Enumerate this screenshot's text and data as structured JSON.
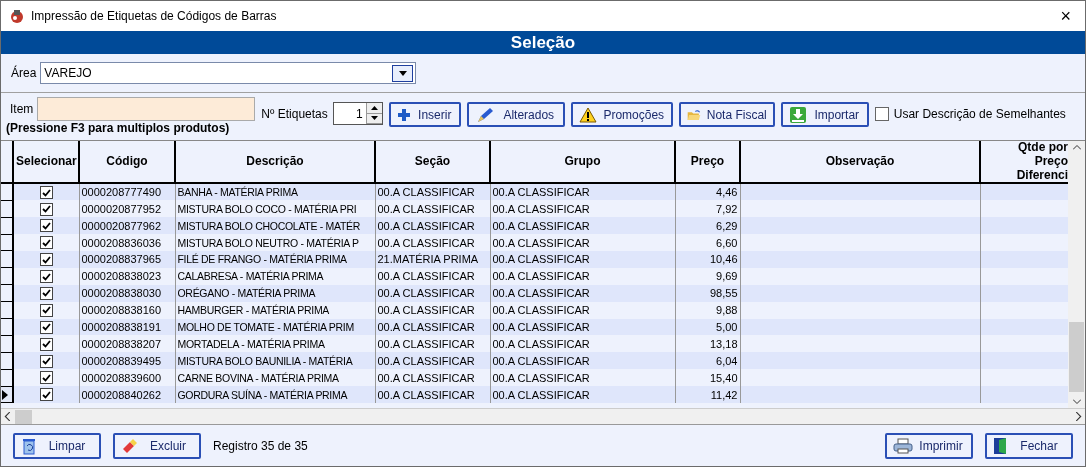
{
  "window": {
    "title": "Impressão de Etiquetas de Códigos de Barras",
    "close": "×"
  },
  "banner": "Seleção",
  "area": {
    "label": "Área",
    "value": "VAREJO"
  },
  "item": {
    "label": "Item",
    "hint": "(Pressione F3 para multiplos produtos)"
  },
  "labels_count": {
    "label": "Nº Etiquetas",
    "value": "1"
  },
  "toolbar": [
    {
      "label": "Inserir",
      "kind": "plus"
    },
    {
      "label": "Alterados",
      "kind": "pen"
    },
    {
      "label": "Promoções",
      "kind": "warning"
    },
    {
      "label": "Nota Fiscal",
      "kind": "folder"
    },
    {
      "label": "Importar",
      "kind": "download"
    }
  ],
  "similar_option": {
    "label": "Usar Descrição de Semelhantes",
    "checked": false
  },
  "table": {
    "columns": [
      "Selecionar",
      "Código",
      "Descrição",
      "Seção",
      "Grupo",
      "Preço",
      "Observação",
      "Qtde por Preço Diferenci"
    ],
    "rows": [
      {
        "selected": false,
        "checked": true,
        "code": "0000208777490",
        "description": "BANHA - MATÉRIA PRIMA",
        "section": "00.A CLASSIFICAR",
        "group": "00.A CLASSIFICAR",
        "price": "4,46"
      },
      {
        "selected": false,
        "checked": true,
        "code": "0000020877952",
        "description": "MISTURA BOLO COCO - MATÉRIA PRI",
        "section": "00.A CLASSIFICAR",
        "group": "00.A CLASSIFICAR",
        "price": "7,92"
      },
      {
        "selected": false,
        "checked": true,
        "code": "0000020877962",
        "description": "MISTURA BOLO CHOCOLATE - MATÉR",
        "section": "00.A CLASSIFICAR",
        "group": "00.A CLASSIFICAR",
        "price": "6,29"
      },
      {
        "selected": false,
        "checked": true,
        "code": "0000208836036",
        "description": "MISTURA BOLO NEUTRO - MATÉRIA P",
        "section": "00.A CLASSIFICAR",
        "group": "00.A CLASSIFICAR",
        "price": "6,60"
      },
      {
        "selected": false,
        "checked": true,
        "code": "0000208837965",
        "description": "FILÉ DE FRANGO - MATÉRIA PRIMA",
        "section": "21.MATÉRIA PRIMA",
        "group": "00.A CLASSIFICAR",
        "price": "10,46"
      },
      {
        "selected": false,
        "checked": true,
        "code": "0000208838023",
        "description": "CALABRESA - MATÉRIA PRIMA",
        "section": "00.A CLASSIFICAR",
        "group": "00.A CLASSIFICAR",
        "price": "9,69"
      },
      {
        "selected": false,
        "checked": true,
        "code": "0000208838030",
        "description": "ORÉGANO - MATÉRIA PRIMA",
        "section": "00.A CLASSIFICAR",
        "group": "00.A CLASSIFICAR",
        "price": "98,55"
      },
      {
        "selected": false,
        "checked": true,
        "code": "0000208838160",
        "description": "HAMBURGER - MATÉRIA PRIMA",
        "section": "00.A CLASSIFICAR",
        "group": "00.A CLASSIFICAR",
        "price": "9,88"
      },
      {
        "selected": false,
        "checked": true,
        "code": "0000208838191",
        "description": "MOLHO DE TOMATE - MATÉRIA PRIM",
        "section": "00.A CLASSIFICAR",
        "group": "00.A CLASSIFICAR",
        "price": "5,00"
      },
      {
        "selected": false,
        "checked": true,
        "code": "0000208838207",
        "description": "MORTADELA - MATÉRIA PRIMA",
        "section": "00.A CLASSIFICAR",
        "group": "00.A CLASSIFICAR",
        "price": "13,18"
      },
      {
        "selected": false,
        "checked": true,
        "code": "0000208839495",
        "description": "MISTURA BOLO BAUNILIA - MATÉRIA",
        "section": "00.A CLASSIFICAR",
        "group": "00.A CLASSIFICAR",
        "price": "6,04"
      },
      {
        "selected": false,
        "checked": true,
        "code": "0000208839600",
        "description": "CARNE BOVINA - MATÉRIA PRIMA",
        "section": "00.A CLASSIFICAR",
        "group": "00.A CLASSIFICAR",
        "price": "15,40"
      },
      {
        "selected": true,
        "checked": true,
        "code": "0000208840262",
        "description": "GORDURA SUÍNA - MATÉRIA PRIMA",
        "section": "00.A CLASSIFICAR",
        "group": "00.A CLASSIFICAR",
        "price": "11,42"
      }
    ]
  },
  "footer": {
    "left_buttons": [
      {
        "label": "Limpar",
        "kind": "recycle"
      },
      {
        "label": "Excluir",
        "kind": "eraser"
      }
    ],
    "status": "Registro 35 de 35",
    "right_buttons": [
      {
        "label": "Imprimir",
        "kind": "printer"
      },
      {
        "label": "Fechar",
        "kind": "door"
      }
    ]
  }
}
